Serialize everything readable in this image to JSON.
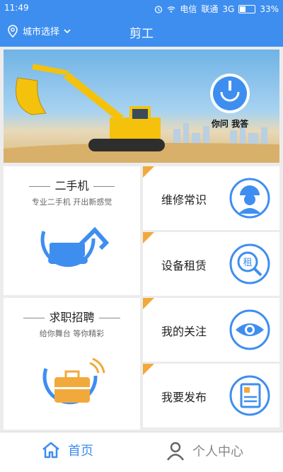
{
  "status": {
    "time": "11:49",
    "carrier1": "电信",
    "carrier2": "联通",
    "network": "3G",
    "battery": "33%",
    "battery_level": 0.33
  },
  "header": {
    "city_label": "城市选择",
    "title": "剪工"
  },
  "banner": {
    "badge_label": "你问 我答"
  },
  "left_cards": [
    {
      "title": "二手机",
      "subtitle": "专业二手机 开出新感觉"
    },
    {
      "title": "求职招聘",
      "subtitle": "给你舞台 等你精彩"
    }
  ],
  "right_cards": [
    {
      "label": "维修常识",
      "icon": "repair-worker-icon"
    },
    {
      "label": "设备租赁",
      "icon": "rent-magnifier-icon",
      "icon_text": "租"
    },
    {
      "label": "我的关注",
      "icon": "eye-icon"
    },
    {
      "label": "我要发布",
      "icon": "document-icon"
    }
  ],
  "bottom_nav": [
    {
      "label": "首页",
      "active": true
    },
    {
      "label": "个人中心",
      "active": false
    }
  ],
  "colors": {
    "primary": "#3e8ef0",
    "accent": "#f2a93b",
    "excavator": "#f4c20d"
  }
}
